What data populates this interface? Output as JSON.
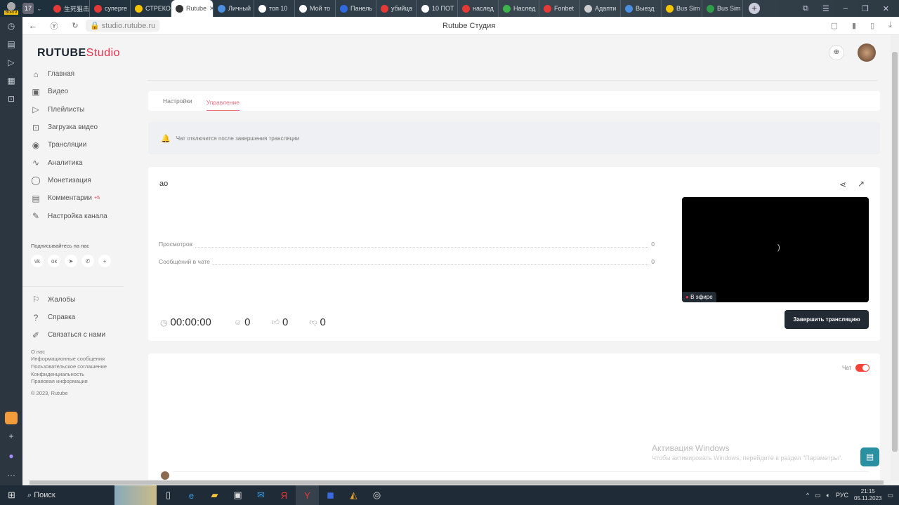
{
  "browser": {
    "profile_label": "Войти",
    "tab_count": "17",
    "tabs": [
      {
        "label": "生死狙击",
        "color": "#e53935"
      },
      {
        "label": "суперге",
        "color": "#e53935"
      },
      {
        "label": "СТРЕКО",
        "color": "#f5c400"
      },
      {
        "label": "Rutube",
        "color": "#333",
        "active": true
      },
      {
        "label": "Личный",
        "color": "#4a8fe0"
      },
      {
        "label": "топ 10",
        "color": "#fff"
      },
      {
        "label": "Мой то",
        "color": "#fff"
      },
      {
        "label": "Панель",
        "color": "#2f6ae0"
      },
      {
        "label": "убийца",
        "color": "#e53935"
      },
      {
        "label": "10 ПОТ",
        "color": "#fff"
      },
      {
        "label": "наслед",
        "color": "#e53935"
      },
      {
        "label": "Наслед",
        "color": "#3bb54a"
      },
      {
        "label": "Fonbet",
        "color": "#e53935"
      },
      {
        "label": "Адапти",
        "color": "#ccc"
      },
      {
        "label": "Выезд",
        "color": "#4a8fe0"
      },
      {
        "label": "Bus Sim",
        "color": "#f5c400"
      },
      {
        "label": "Bus Sim",
        "color": "#2e9e4a"
      }
    ],
    "url": "studio.rutube.ru",
    "page_title": "Rutube Студия"
  },
  "logo": {
    "brand": "RUTUBE",
    "product": "Studio",
    "accent": "#e8304b"
  },
  "sidebar": {
    "items": [
      {
        "label": "Главная",
        "icon": "home-icon",
        "glyph": "⌂"
      },
      {
        "label": "Видео",
        "icon": "video-icon",
        "glyph": "▣"
      },
      {
        "label": "Плейлисты",
        "icon": "playlist-icon",
        "glyph": "▷"
      },
      {
        "label": "Загрузка видео",
        "icon": "upload-icon",
        "glyph": "⊡"
      },
      {
        "label": "Трансляции",
        "icon": "broadcast-icon",
        "glyph": "◉"
      },
      {
        "label": "Аналитика",
        "icon": "analytics-icon",
        "glyph": "∿"
      },
      {
        "label": "Монетизация",
        "icon": "coin-icon",
        "glyph": "◯"
      },
      {
        "label": "Комментарии",
        "icon": "comments-icon",
        "glyph": "▤",
        "badge": "+5"
      },
      {
        "label": "Настройка канала",
        "icon": "wand-icon",
        "glyph": "✎"
      }
    ],
    "subscribe_label": "Подписывайтесь на нас",
    "socials": [
      {
        "icon": "vk-icon",
        "glyph": "vk"
      },
      {
        "icon": "ok-icon",
        "glyph": "ок"
      },
      {
        "icon": "telegram-icon",
        "glyph": "➤"
      },
      {
        "icon": "viber-icon",
        "glyph": "✆"
      },
      {
        "icon": "more-icon",
        "glyph": "+"
      }
    ],
    "bottom_items": [
      {
        "label": "Жалобы",
        "icon": "flag-icon",
        "glyph": "⚐"
      },
      {
        "label": "Справка",
        "icon": "help-icon",
        "glyph": "?"
      },
      {
        "label": "Связаться с нами",
        "icon": "pen-icon",
        "glyph": "✐"
      }
    ],
    "footer_links": [
      "О нас",
      "Информационные сообщения",
      "Пользовательское соглашение",
      "Конфиденциальность",
      "Правовая информация"
    ],
    "copyright": "© 2023, Rutube"
  },
  "tabs": [
    {
      "label": "Настройки"
    },
    {
      "label": "Управление",
      "active": true
    }
  ],
  "notice": "Чат отключится после завершения трансляции",
  "stream": {
    "title": "ао",
    "stats": [
      {
        "label": "Просмотров",
        "value": "0"
      },
      {
        "label": "Сообщений в чате",
        "value": "0"
      }
    ],
    "duration": "00:00:00",
    "viewers": "0",
    "likes": "0",
    "dislikes": "0",
    "live_label": "В эфире",
    "end_button": "Завершить трансляцию"
  },
  "chat": {
    "toggle_label": "Чат",
    "enabled": true
  },
  "watermark": {
    "title": "Активация Windows",
    "text": "Чтобы активировать Windows, перейдите в раздел \"Параметры\"."
  },
  "taskbar": {
    "search": "Поиск",
    "lang": "РУС",
    "time": "21:15",
    "date": "05.11.2023"
  }
}
